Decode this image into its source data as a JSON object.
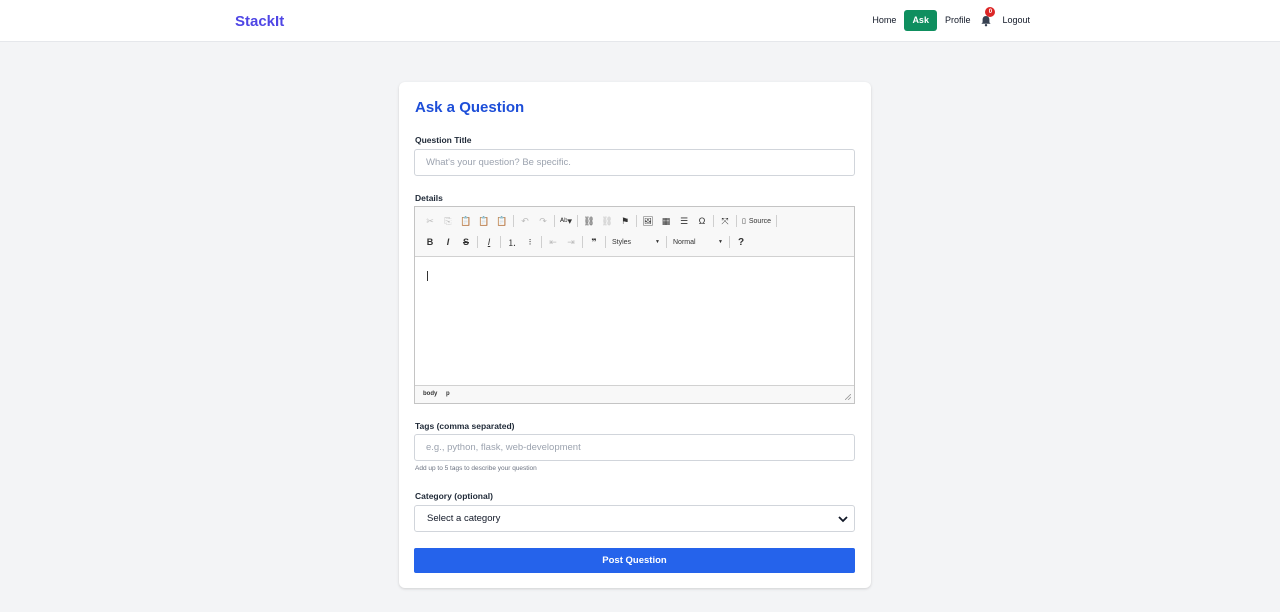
{
  "brand": "StackIt",
  "nav": {
    "home": "Home",
    "ask": "Ask",
    "profile": "Profile",
    "notification_count": "0",
    "logout": "Logout"
  },
  "form": {
    "title": "Ask a Question",
    "question_title_label": "Question Title",
    "question_title_placeholder": "What's your question? Be specific.",
    "details_label": "Details",
    "editor": {
      "source_label": "Source",
      "styles_label": "Styles",
      "format_label": "Normal",
      "help_label": "?",
      "path": [
        "body",
        "p"
      ]
    },
    "tags_label": "Tags (comma separated)",
    "tags_placeholder": "e.g., python, flask, web-development",
    "tags_hint": "Add up to 5 tags to describe your question",
    "category_label": "Category (optional)",
    "category_selected": "Select a category",
    "submit_label": "Post Question"
  },
  "colors": {
    "brand": "#4f46e5",
    "ask_button": "#0f8f5f",
    "title": "#1d4ed8",
    "submit": "#2563eb",
    "badge": "#dc2626"
  }
}
